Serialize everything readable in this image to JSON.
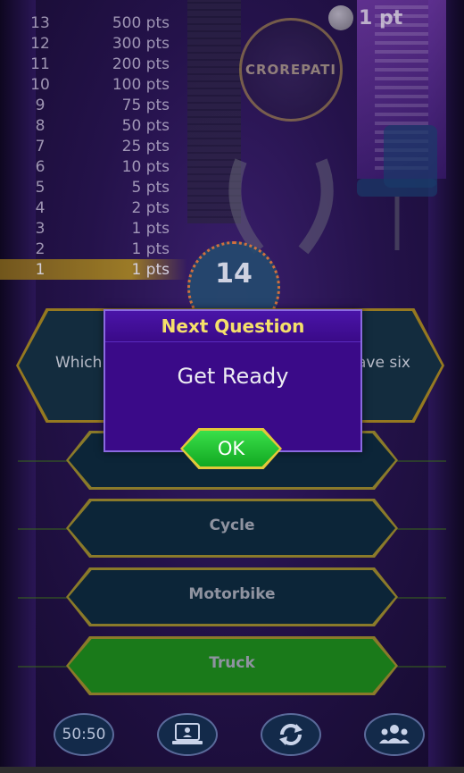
{
  "coins": {
    "label": "1 pt"
  },
  "logo": {
    "text": "CROREPATI"
  },
  "ladder": [
    {
      "num": "13",
      "pts": "500 pts"
    },
    {
      "num": "12",
      "pts": "300 pts"
    },
    {
      "num": "11",
      "pts": "200 pts"
    },
    {
      "num": "10",
      "pts": "100 pts"
    },
    {
      "num": "9",
      "pts": "75 pts"
    },
    {
      "num": "8",
      "pts": "50 pts"
    },
    {
      "num": "7",
      "pts": "25 pts"
    },
    {
      "num": "6",
      "pts": "10 pts"
    },
    {
      "num": "5",
      "pts": "5 pts"
    },
    {
      "num": "4",
      "pts": "2 pts"
    },
    {
      "num": "3",
      "pts": "1 pts"
    },
    {
      "num": "2",
      "pts": "1 pts"
    },
    {
      "num": "1",
      "pts": "1 pts"
    }
  ],
  "timer": {
    "value": "14"
  },
  "question": {
    "left_text": "Which",
    "right_text": "ave six"
  },
  "answers": [
    "",
    "Cycle",
    "Motorbike",
    "Truck"
  ],
  "dialog": {
    "title": "Next Question",
    "message": "Get Ready",
    "ok_label": "OK"
  },
  "lifelines": {
    "fifty_fifty": "50:50"
  }
}
